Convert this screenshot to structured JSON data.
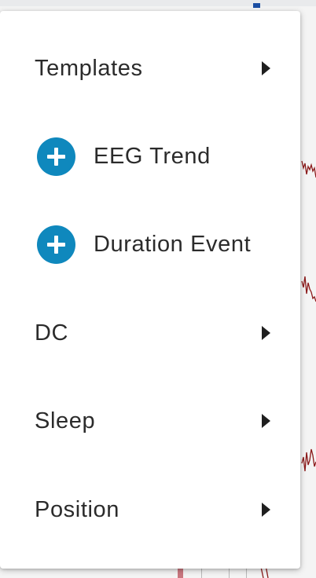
{
  "menu": {
    "items": [
      {
        "label": "Templates",
        "type": "submenu",
        "icon": "chevron-right-icon"
      },
      {
        "label": "EEG Trend",
        "type": "add",
        "icon": "plus-circle-icon"
      },
      {
        "label": "Duration Event",
        "type": "add",
        "icon": "plus-circle-icon"
      },
      {
        "label": "DC",
        "type": "submenu",
        "icon": "chevron-right-icon"
      },
      {
        "label": "Sleep",
        "type": "submenu",
        "icon": "chevron-right-icon"
      },
      {
        "label": "Position",
        "type": "submenu",
        "icon": "chevron-right-icon"
      }
    ]
  },
  "colors": {
    "add_icon": "#0f88bd",
    "text": "#2b2b2b",
    "trace": "#8b1a1a"
  }
}
